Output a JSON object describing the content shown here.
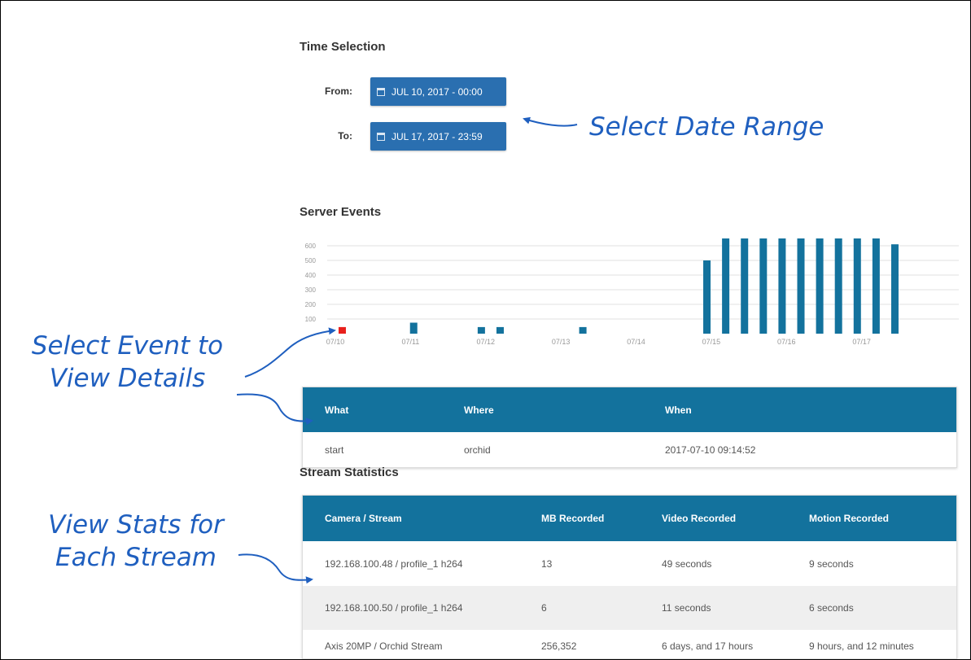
{
  "time_selection": {
    "title": "Time Selection",
    "from_label": "From:",
    "from_value": "JUL 10, 2017 - 00:00",
    "to_label": "To:",
    "to_value": "JUL 17, 2017 - 23:59"
  },
  "annotations": {
    "date_range": "Select Date Range",
    "event_line1": "Select Event to",
    "event_line2": "View Details",
    "stats_line1": "View Stats for",
    "stats_line2": "Each Stream"
  },
  "server_events": {
    "title": "Server Events"
  },
  "chart_data": {
    "type": "bar",
    "title": "Server Events",
    "x_tick_labels": [
      "07/10",
      "07/11",
      "07/12",
      "07/13",
      "07/14",
      "07/15",
      "07/16",
      "07/17"
    ],
    "y_ticks": [
      100,
      200,
      300,
      400,
      500,
      600
    ],
    "ylim": [
      0,
      650
    ],
    "xlim_days": [
      0,
      8.4
    ],
    "grid": true,
    "selected_color": "#e8201c",
    "bar_color": "#13729d",
    "series": [
      {
        "points": [
          {
            "day": 0.2,
            "value": 45,
            "selected": true
          },
          {
            "day": 1.15,
            "value": 75
          },
          {
            "day": 2.05,
            "value": 45
          },
          {
            "day": 2.3,
            "value": 45
          },
          {
            "day": 3.4,
            "value": 45
          },
          {
            "day": 5.05,
            "value": 500
          },
          {
            "day": 5.3,
            "value": 650
          },
          {
            "day": 5.55,
            "value": 650
          },
          {
            "day": 5.8,
            "value": 650
          },
          {
            "day": 6.05,
            "value": 650
          },
          {
            "day": 6.3,
            "value": 650
          },
          {
            "day": 6.55,
            "value": 650
          },
          {
            "day": 6.8,
            "value": 650
          },
          {
            "day": 7.05,
            "value": 650
          },
          {
            "day": 7.3,
            "value": 650
          },
          {
            "day": 7.55,
            "value": 610
          }
        ]
      }
    ]
  },
  "events_table": {
    "headers": [
      "What",
      "Where",
      "When"
    ],
    "rows": [
      [
        "start",
        "orchid",
        "2017-07-10 09:14:52"
      ]
    ]
  },
  "stream_stats": {
    "title": "Stream Statistics",
    "headers": [
      "Camera / Stream",
      "MB Recorded",
      "Video Recorded",
      "Motion Recorded"
    ],
    "rows": [
      [
        "192.168.100.48 / profile_1 h264",
        "13",
        "49 seconds",
        "9 seconds"
      ],
      [
        "192.168.100.50 / profile_1 h264",
        "6",
        "11 seconds",
        "6 seconds"
      ],
      [
        "Axis 20MP / Orchid Stream",
        "256,352",
        "6 days, and 17 hours",
        "9 hours, and 12 minutes"
      ]
    ]
  },
  "colors": {
    "header_bg": "#13729d",
    "button_bg": "#2a6fb0",
    "annotation": "#1f5fbf"
  }
}
